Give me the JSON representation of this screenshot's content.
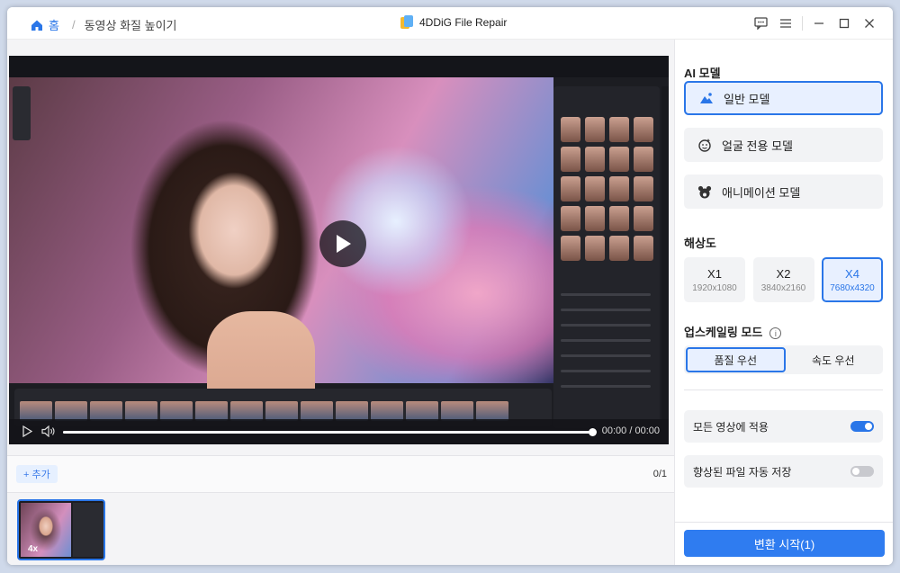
{
  "breadcrumb": {
    "home": "홈",
    "separator": "/",
    "current": "동영상 화질 높이기"
  },
  "app": {
    "title": "4DDiG File Repair"
  },
  "player": {
    "time": "00:00 / 00:00",
    "progress": 1.0
  },
  "queue": {
    "add_label": "+ 추가",
    "count": "0/1",
    "thumb_badge": "4x"
  },
  "ai_model": {
    "title": "AI 모델",
    "options": [
      {
        "label": "일반 모델",
        "icon": "landscape-icon",
        "active": true
      },
      {
        "label": "얼굴 전용 모델",
        "icon": "face-icon",
        "active": false
      },
      {
        "label": "애니메이션 모델",
        "icon": "bear-icon",
        "active": false
      }
    ]
  },
  "resolution": {
    "title": "해상도",
    "options": [
      {
        "label": "X1",
        "size": "1920x1080",
        "active": false
      },
      {
        "label": "X2",
        "size": "3840x2160",
        "active": false
      },
      {
        "label": "X4",
        "size": "7680x4320",
        "active": true
      }
    ]
  },
  "upscale_mode": {
    "title": "업스케일링 모드",
    "options": [
      {
        "label": "품질 우선",
        "active": true
      },
      {
        "label": "속도 우선",
        "active": false
      }
    ]
  },
  "settings": {
    "apply_all": {
      "label": "모든 영상에 적용",
      "on": true
    },
    "auto_save": {
      "label": "향상된 파일 자동 저장",
      "on": false
    }
  },
  "start": {
    "label": "변환 시작(1)"
  },
  "colors": {
    "accent": "#2a76e8",
    "button": "#2f7cf0"
  }
}
